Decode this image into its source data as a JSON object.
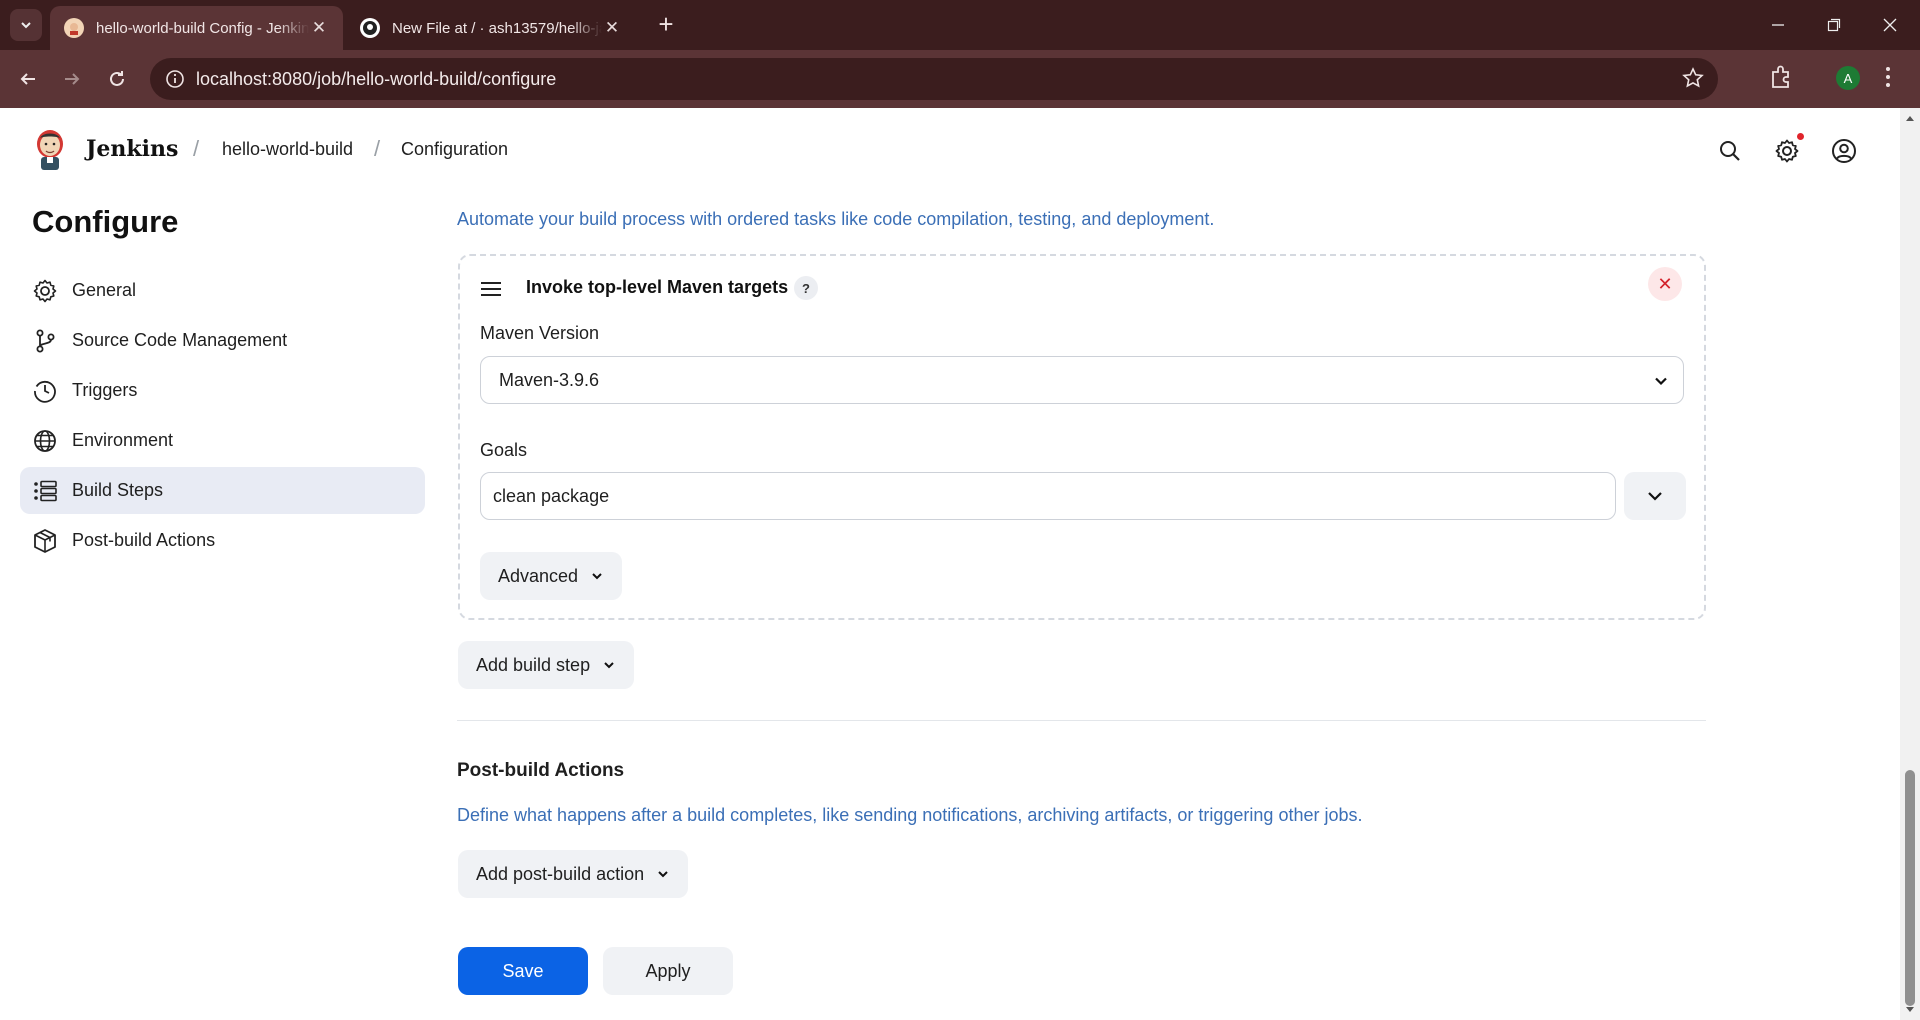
{
  "browser": {
    "tabs": [
      {
        "title": "hello-world-build Config - Jenkins",
        "active": true,
        "icon": "jenkins-favicon"
      },
      {
        "title": "New File at / · ash13579/hello-java",
        "active": false,
        "icon": "github-favicon"
      }
    ],
    "url": "localhost:8080/job/hello-world-build/configure",
    "profile_initial": "A"
  },
  "header": {
    "brand": "Jenkins",
    "breadcrumbs": [
      "hello-world-build",
      "Configuration"
    ]
  },
  "sidebar": {
    "title": "Configure",
    "items": [
      {
        "label": "General",
        "icon": "gear-icon"
      },
      {
        "label": "Source Code Management",
        "icon": "git-branch-icon"
      },
      {
        "label": "Triggers",
        "icon": "clock-icon"
      },
      {
        "label": "Environment",
        "icon": "globe-icon"
      },
      {
        "label": "Build Steps",
        "icon": "list-icon",
        "active": true
      },
      {
        "label": "Post-build Actions",
        "icon": "package-icon"
      }
    ]
  },
  "build_steps": {
    "description": "Automate your build process with ordered tasks like code compilation, testing, and deployment.",
    "step": {
      "title": "Invoke top-level Maven targets",
      "help": "?",
      "remove": "✕",
      "maven_version_label": "Maven Version",
      "maven_version_value": "Maven-3.9.6",
      "goals_label": "Goals",
      "goals_value": "clean package",
      "advanced_label": "Advanced"
    },
    "add_step_label": "Add build step"
  },
  "post_build": {
    "title": "Post-build Actions",
    "description": "Define what happens after a build completes, like sending notifications, archiving artifacts, or triggering other jobs.",
    "add_action_label": "Add post-build action"
  },
  "actions": {
    "save": "Save",
    "apply": "Apply"
  },
  "colors": {
    "accent": "#0b63e5",
    "link_text": "#3b6fb6",
    "browser_frame": "#3b1d1e"
  }
}
